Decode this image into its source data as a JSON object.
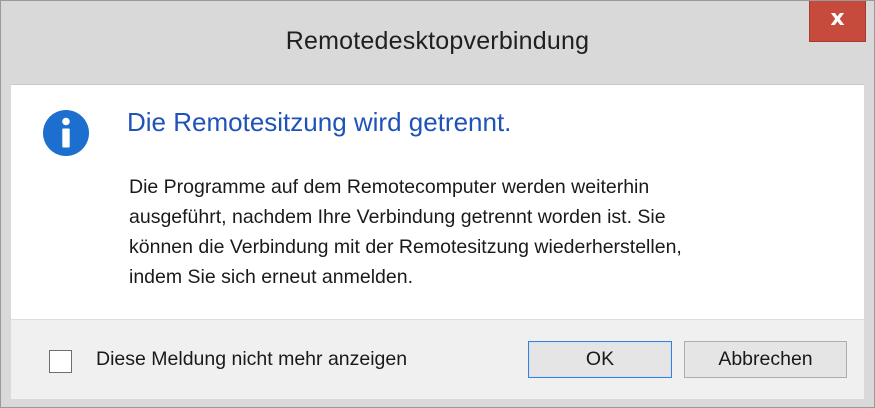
{
  "window": {
    "title": "Remotedesktopverbindung",
    "close_label": "x"
  },
  "content": {
    "icon": "info-icon",
    "heading": "Die Remotesitzung wird getrennt.",
    "message_lines": [
      "Die Programme auf dem Remotecomputer werden weiterhin",
      "ausgeführt, nachdem Ihre Verbindung getrennt worden ist. Sie",
      "können die Verbindung mit der Remotesitzung wiederherstellen,",
      "indem Sie sich erneut anmelden."
    ]
  },
  "footer": {
    "checkbox_label": "Diese Meldung nicht mehr anzeigen",
    "checkbox_checked": false,
    "ok_label": "OK",
    "cancel_label": "Abbrechen"
  },
  "colors": {
    "heading": "#1f53b8",
    "icon": "#1c6fcf",
    "close_button": "#c74b3d"
  }
}
